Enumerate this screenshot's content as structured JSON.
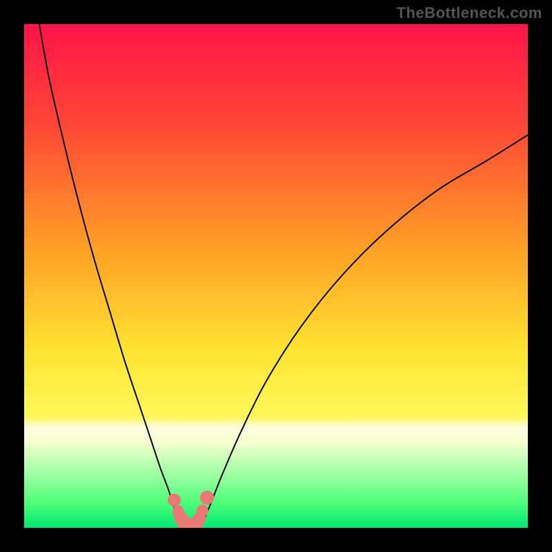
{
  "watermark": "TheBottleneck.com",
  "chart_data": {
    "type": "line",
    "title": "",
    "xlabel": "",
    "ylabel": "",
    "xlim": [
      0,
      100
    ],
    "ylim": [
      0,
      100
    ],
    "grid": false,
    "legend": false,
    "annotations": [],
    "background_gradient": {
      "stops": [
        {
          "offset": 0.0,
          "color": "#ff1449"
        },
        {
          "offset": 0.2,
          "color": "#ff4736"
        },
        {
          "offset": 0.45,
          "color": "#ffa126"
        },
        {
          "offset": 0.65,
          "color": "#ffe432"
        },
        {
          "offset": 0.78,
          "color": "#fff85a"
        },
        {
          "offset": 0.8,
          "color": "#fffee0"
        },
        {
          "offset": 0.83,
          "color": "#f5ffd0"
        },
        {
          "offset": 0.95,
          "color": "#4fff7a"
        },
        {
          "offset": 1.0,
          "color": "#00e874"
        }
      ]
    },
    "series": [
      {
        "name": "left-curve",
        "x": [
          3,
          5,
          8,
          11,
          14,
          17,
          20,
          23,
          25,
          27,
          28.5,
          29.5,
          30.2,
          30.8,
          31.2,
          31.5
        ],
        "y": [
          100,
          89,
          76,
          64,
          53,
          43,
          33,
          24,
          18,
          12,
          8,
          5,
          3,
          1.6,
          0.8,
          0.3
        ]
      },
      {
        "name": "right-curve",
        "x": [
          35,
          35.5,
          36.3,
          37.5,
          39.5,
          43,
          48,
          55,
          63,
          72,
          82,
          92,
          100
        ],
        "y": [
          0.3,
          1.2,
          3,
          6,
          11,
          19,
          29,
          40,
          50,
          59,
          67,
          73,
          78
        ]
      },
      {
        "name": "bottom-connector",
        "x": [
          31.5,
          32,
          33,
          34,
          35
        ],
        "y": [
          0.3,
          0.1,
          0.05,
          0.1,
          0.3
        ]
      }
    ],
    "markers": {
      "name": "salmon-dots-cluster",
      "color": "#e97a73",
      "points": [
        {
          "x": 29.8,
          "y": 5.5,
          "r": 1.3
        },
        {
          "x": 30.6,
          "y": 3.2,
          "r": 1.2
        },
        {
          "x": 31.2,
          "y": 1.8,
          "r": 1.4
        },
        {
          "x": 31.8,
          "y": 0.9,
          "r": 1.4
        },
        {
          "x": 32.6,
          "y": 0.5,
          "r": 1.4
        },
        {
          "x": 33.4,
          "y": 0.5,
          "r": 1.4
        },
        {
          "x": 34.2,
          "y": 0.9,
          "r": 1.4
        },
        {
          "x": 34.8,
          "y": 1.8,
          "r": 1.3
        },
        {
          "x": 35.4,
          "y": 3.4,
          "r": 1.2
        },
        {
          "x": 36.3,
          "y": 6.0,
          "r": 1.4
        }
      ]
    }
  }
}
